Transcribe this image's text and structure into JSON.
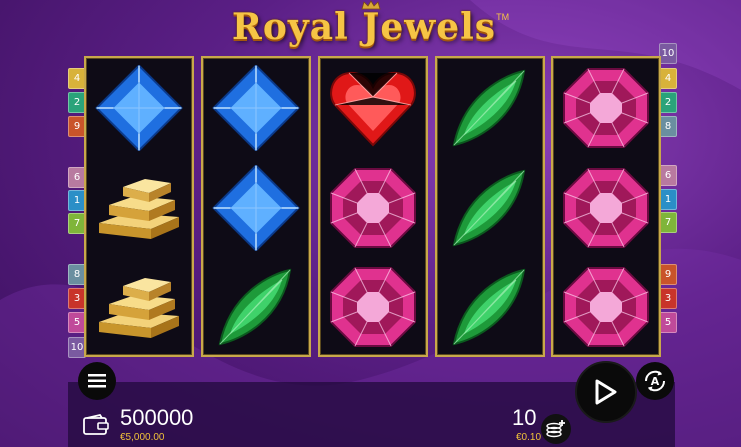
{
  "game": {
    "title": "Royal Jewels",
    "trademark": "TM"
  },
  "reels": [
    [
      "sapphire-square",
      "gold-bars",
      "gold-bars"
    ],
    [
      "sapphire-square",
      "sapphire-square",
      "emerald-marquise"
    ],
    [
      "ruby-heart",
      "amethyst-octagon",
      "amethyst-octagon"
    ],
    [
      "emerald-marquise",
      "emerald-marquise",
      "emerald-marquise"
    ],
    [
      "amethyst-octagon",
      "amethyst-octagon",
      "amethyst-octagon"
    ]
  ],
  "paylines_left": [
    {
      "label": "4",
      "color": "#d8b23a"
    },
    {
      "label": "2",
      "color": "#2aa37a"
    },
    {
      "label": "9",
      "color": "#c9542a"
    },
    {
      "label": "6",
      "color": "#b87aa0"
    },
    {
      "label": "1",
      "color": "#2b8fc7"
    },
    {
      "label": "7",
      "color": "#7fb53a"
    },
    {
      "label": "8",
      "color": "#6a8fa0"
    },
    {
      "label": "3",
      "color": "#c8342a"
    },
    {
      "label": "5",
      "color": "#c04a9a"
    },
    {
      "label": "10",
      "color": "#7a5aa0"
    }
  ],
  "paylines_right": [
    {
      "label": "10",
      "color": "#7a5aa0"
    },
    {
      "label": "4",
      "color": "#d8b23a"
    },
    {
      "label": "2",
      "color": "#2aa37a"
    },
    {
      "label": "8",
      "color": "#6a8fa0"
    },
    {
      "label": "6",
      "color": "#b87aa0"
    },
    {
      "label": "1",
      "color": "#2b8fc7"
    },
    {
      "label": "7",
      "color": "#7fb53a"
    },
    {
      "label": "9",
      "color": "#c9542a"
    },
    {
      "label": "3",
      "color": "#c8342a"
    },
    {
      "label": "5",
      "color": "#c04a9a"
    }
  ],
  "balance": {
    "credits": "500000",
    "money": "€5,000.00"
  },
  "bet": {
    "credits": "10",
    "money": "€0.10"
  },
  "icons": {
    "menu": "hamburger-icon",
    "spin": "play-icon",
    "autoplay": "autoplay-icon",
    "wallet": "wallet-icon",
    "coins": "coins-plus-icon"
  }
}
